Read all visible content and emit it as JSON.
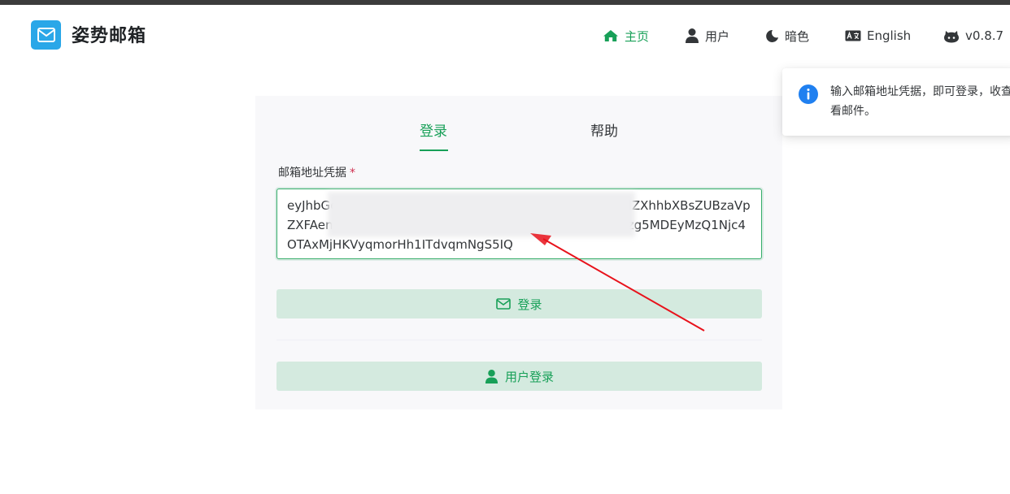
{
  "header": {
    "brand": "姿势邮箱",
    "nav": {
      "home": "主页",
      "user": "用户",
      "dark": "暗色",
      "lang": "English",
      "version": "v0.8.7"
    }
  },
  "tabs": {
    "login": "登录",
    "help": "帮助",
    "active": "登录"
  },
  "form": {
    "label": "邮箱地址凭据",
    "required_mark": "*",
    "credential_value": "eyJhbGciOiJIUzI1NiIsInR5cCI6IkpXVCJ9.eyJhZGRyZXNzIjoiZXhhbXBsZUBzaVpZXFAenN4d3ouY29tIiwiYWRkcmVzc19pZCI6MTIzNDU2Nzg5MDEyMzQ1Njc4OTAxMjHKVyqmorHh1ITdvqmNgS5IQ",
    "login_button": "登录",
    "user_login_button": "用户登录"
  },
  "notification": {
    "text": "输入邮箱地址凭据，即可登录，收查看邮件。"
  },
  "colors": {
    "accent": "#18a058",
    "logo": "#2aa7e8",
    "button_bg": "#d4eadf",
    "info": "#2080f0",
    "annotation_arrow": "#e8121b"
  }
}
